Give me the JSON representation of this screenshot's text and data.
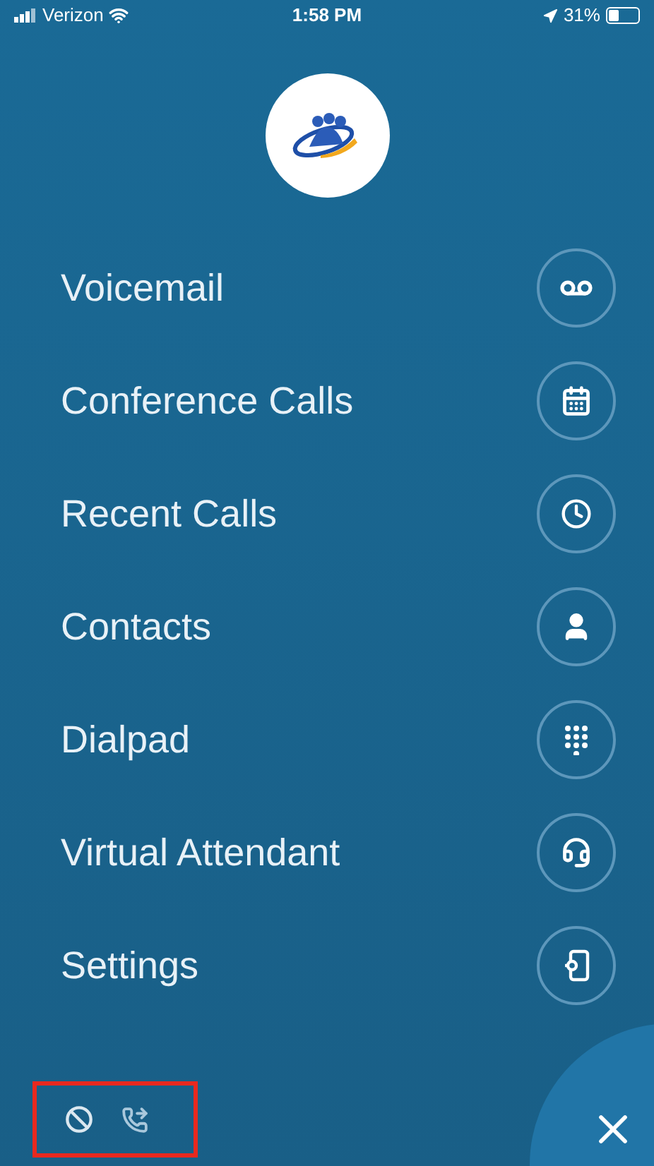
{
  "status_bar": {
    "carrier": "Verizon",
    "time": "1:58 PM",
    "battery": "31%"
  },
  "menu": [
    {
      "label": "Voicemail",
      "kind": "voicemail"
    },
    {
      "label": "Conference Calls",
      "kind": "calendar"
    },
    {
      "label": "Recent Calls",
      "kind": "clock"
    },
    {
      "label": "Contacts",
      "kind": "person"
    },
    {
      "label": "Dialpad",
      "kind": "dialpad"
    },
    {
      "label": "Virtual Attendant",
      "kind": "headset"
    },
    {
      "label": "Settings",
      "kind": "settings"
    }
  ]
}
